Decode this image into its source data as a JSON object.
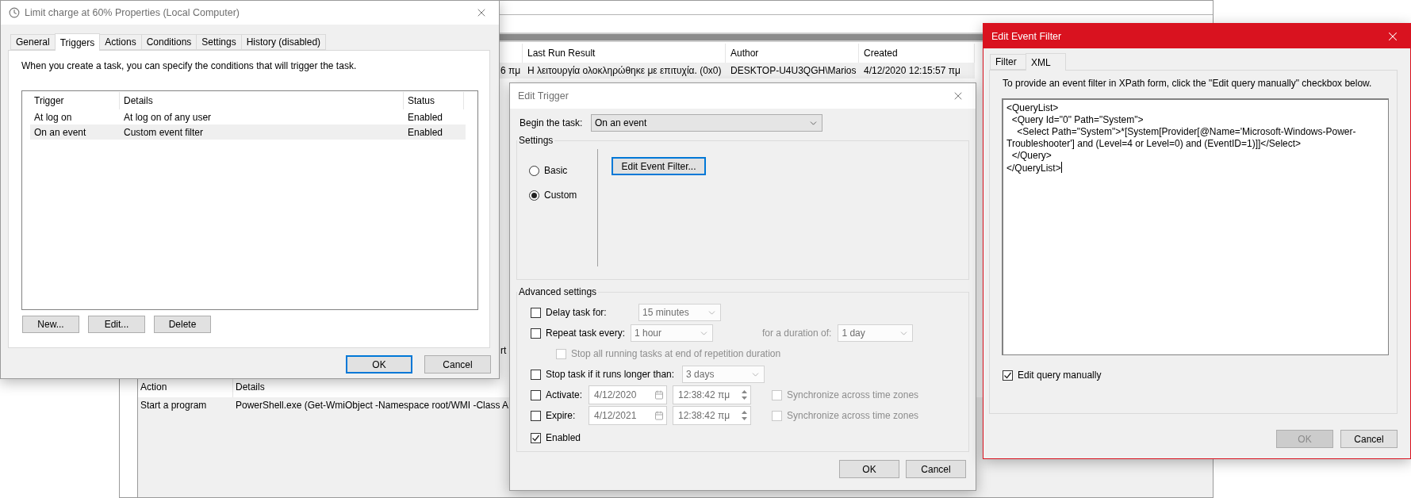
{
  "background_app": {
    "upper_table": {
      "columns": [
        "Last Run Result",
        "Author",
        "Created"
      ],
      "rows": [
        {
          "cut_cell": "6 πμ",
          "cells": [
            "Η λειτουργία ολοκληρώθηκε με επιτυχία. (0x0)",
            "DESKTOP-U4U3QGH\\Marios",
            "4/12/2020 12:15:57 πμ"
          ],
          "selected": true
        }
      ]
    },
    "fragment": "rt",
    "lower_table": {
      "columns": [
        "Action",
        "Details"
      ],
      "rows": [
        {
          "cells": [
            "Start a program",
            "PowerShell.exe (Get-WmiObject -Namespace root/WMI -Class A"
          ]
        }
      ]
    }
  },
  "properties_dialog": {
    "title": "Limit charge at 60% Properties (Local Computer)",
    "tabs": [
      {
        "label": "General",
        "selected": false
      },
      {
        "label": "Triggers",
        "selected": true
      },
      {
        "label": "Actions",
        "selected": false
      },
      {
        "label": "Conditions",
        "selected": false
      },
      {
        "label": "Settings",
        "selected": false
      },
      {
        "label": "History (disabled)",
        "selected": false
      }
    ],
    "description": "When you create a task, you can specify the conditions that will trigger the task.",
    "triggers_table": {
      "columns": [
        "Trigger",
        "Details",
        "Status"
      ],
      "rows": [
        {
          "cells": [
            "At log on",
            "At log on of any user",
            "Enabled"
          ],
          "selected": false
        },
        {
          "cells": [
            "On an event",
            "Custom event filter",
            "Enabled"
          ],
          "selected": true
        }
      ]
    },
    "list_buttons": [
      "New...",
      "Edit...",
      "Delete"
    ],
    "buttons": [
      {
        "label": "OK",
        "default": true
      },
      {
        "label": "Cancel",
        "default": false
      }
    ]
  },
  "edit_trigger": {
    "title": "Edit Trigger",
    "begin_label": "Begin the task:",
    "begin_value": "On an event",
    "settings_label": "Settings",
    "schedule_options": [
      {
        "label": "Basic",
        "selected": false
      },
      {
        "label": "Custom",
        "selected": true
      }
    ],
    "filter_button": "Edit Event Filter...",
    "advanced_label": "Advanced settings",
    "advanced_rows": [
      {
        "kind": "dropdown",
        "label": "Delay task for:",
        "checked": false,
        "value": "15 minutes"
      },
      {
        "kind": "repeat",
        "label": "Repeat task every:",
        "checked": false,
        "value": "1 hour",
        "duration_label": "for a duration of:",
        "duration_value": "1 day"
      },
      {
        "kind": "sub_check",
        "label": "Stop all running tasks at end of repetition duration",
        "checked": false,
        "disabled": true
      },
      {
        "kind": "dropdown",
        "label": "Stop task if it runs longer than:",
        "checked": false,
        "value": "3 days"
      },
      {
        "kind": "datetime",
        "label": "Activate:",
        "checked": false,
        "date": "4/12/2020",
        "time": "12:38:42 πμ",
        "sync_label": "Synchronize across time zones",
        "sync_checked": false
      },
      {
        "kind": "datetime",
        "label": "Expire:",
        "checked": false,
        "date": "4/12/2021",
        "time": "12:38:42 πμ",
        "sync_label": "Synchronize across time zones",
        "sync_checked": false
      },
      {
        "kind": "check",
        "label": "Enabled",
        "checked": true
      }
    ],
    "buttons": [
      "OK",
      "Cancel"
    ]
  },
  "event_filter": {
    "title": "Edit Event Filter",
    "tabs": [
      {
        "label": "Filter",
        "selected": false
      },
      {
        "label": "XML",
        "selected": true
      }
    ],
    "instruction": "To provide an event filter in XPath form, click the \"Edit query manually\" checkbox below.",
    "query_lines": [
      "<QueryList>",
      "  <Query Id=\"0\" Path=\"System\">",
      "    <Select Path=\"System\">*[System[Provider[@Name='Microsoft-Windows-Power-Troubleshooter'] and (Level=4 or Level=0) and (EventID=1)]]</Select>",
      "  </Query>",
      "</QueryList>"
    ],
    "manual_edit": {
      "label": "Edit query manually",
      "checked": true
    },
    "buttons": [
      {
        "label": "OK",
        "disabled": true
      },
      {
        "label": "Cancel",
        "disabled": false
      }
    ]
  }
}
